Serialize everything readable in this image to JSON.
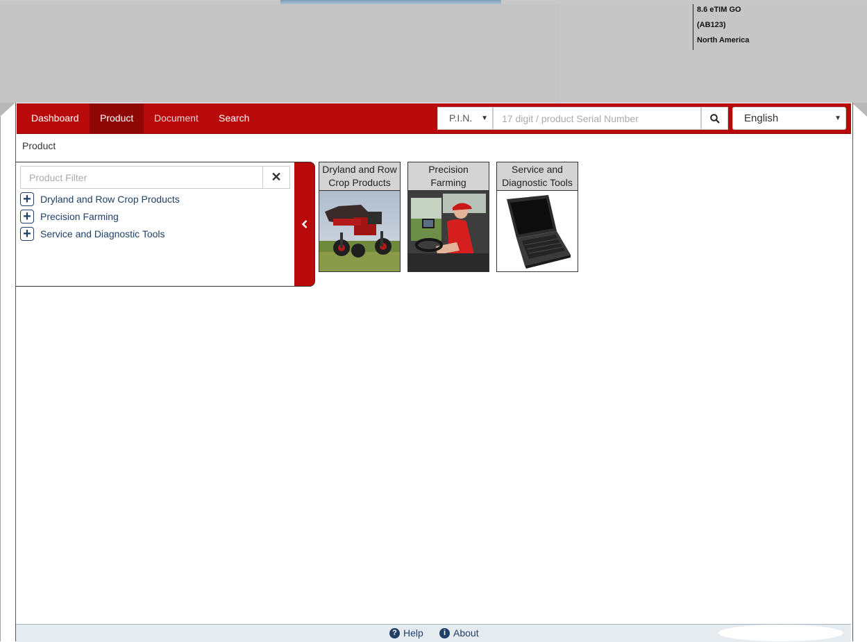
{
  "header": {
    "version": "8.6 eTIM GO",
    "code": "(AB123)",
    "region": "North America"
  },
  "nav": {
    "items": [
      {
        "label": "Dashboard"
      },
      {
        "label": "Product"
      },
      {
        "label": "Document"
      },
      {
        "label": "Search"
      }
    ],
    "active": "Product",
    "pin_select_value": "P.I.N.",
    "serial_placeholder": "17 digit / product Serial Number",
    "language": "English"
  },
  "breadcrumb": "Product",
  "tree": {
    "filter_placeholder": "Product Filter",
    "items": [
      {
        "label": "Dryland and Row Crop Products"
      },
      {
        "label": "Precision Farming"
      },
      {
        "label": "Service and Diagnostic Tools"
      }
    ]
  },
  "tiles": [
    {
      "title": "Dryland and Row Crop Products"
    },
    {
      "title": "Precision Farming"
    },
    {
      "title": "Service and Diagnostic Tools"
    }
  ],
  "footer": {
    "help": "Help",
    "about": "About"
  },
  "colors": {
    "nav_red": "#b80a0a",
    "nav_active": "#8e0808",
    "link_blue": "#1f3f66"
  }
}
